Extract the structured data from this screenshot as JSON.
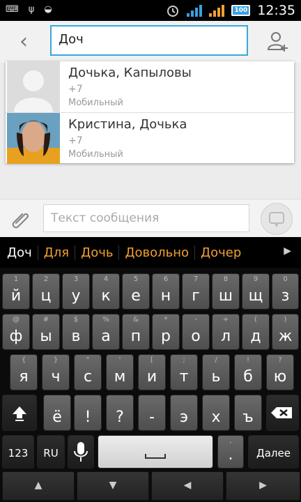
{
  "status": {
    "time": "12:35",
    "battery": "100",
    "left_icons": [
      "keyboard-icon",
      "usb-icon",
      "android-icon"
    ]
  },
  "header": {
    "recipient_value": "Доч"
  },
  "suggestions": [
    {
      "name": "Дочька, Капыловы",
      "number": "+7",
      "type": "Мобильный"
    },
    {
      "name": "Кристина, Дочька",
      "number": "+7",
      "type": "Мобильный"
    }
  ],
  "compose": {
    "placeholder": "Текст сообщения"
  },
  "keyboard": {
    "suggestions": [
      "Доч",
      "Для",
      "Дочь",
      "Довольно",
      "Дочер"
    ],
    "row1": [
      {
        "main": "й",
        "sub": "1"
      },
      {
        "main": "ц",
        "sub": "2"
      },
      {
        "main": "у",
        "sub": "3"
      },
      {
        "main": "к",
        "sub": "4"
      },
      {
        "main": "е",
        "sub": "5"
      },
      {
        "main": "н",
        "sub": "6"
      },
      {
        "main": "г",
        "sub": "7"
      },
      {
        "main": "ш",
        "sub": "8"
      },
      {
        "main": "щ",
        "sub": "9"
      },
      {
        "main": "з",
        "sub": "0"
      }
    ],
    "row2": [
      {
        "main": "ф",
        "sub": "@"
      },
      {
        "main": "ы",
        "sub": "#"
      },
      {
        "main": "в",
        "sub": "$"
      },
      {
        "main": "а",
        "sub": "%"
      },
      {
        "main": "п",
        "sub": "&"
      },
      {
        "main": "р",
        "sub": "*"
      },
      {
        "main": "о",
        "sub": "-"
      },
      {
        "main": "л",
        "sub": "+"
      },
      {
        "main": "д",
        "sub": "("
      },
      {
        "main": "ж",
        "sub": ")"
      }
    ],
    "row3": [
      {
        "main": "я",
        "sub": "{"
      },
      {
        "main": "ч",
        "sub": "}"
      },
      {
        "main": "с",
        "sub": "\""
      },
      {
        "main": "м",
        "sub": "'"
      },
      {
        "main": "и",
        "sub": "["
      },
      {
        "main": "т",
        "sub": ";"
      },
      {
        "main": "ь",
        "sub": "/"
      },
      {
        "main": "б",
        "sub": "!"
      },
      {
        "main": "ю",
        "sub": "?"
      }
    ],
    "row4": [
      {
        "main": "ё",
        "sub": ""
      },
      {
        "main": "!",
        "sub": ""
      },
      {
        "main": "?",
        "sub": ""
      },
      {
        "main": "-",
        "sub": ""
      },
      {
        "main": "э",
        "sub": ""
      },
      {
        "main": "х",
        "sub": ""
      },
      {
        "main": "ъ",
        "sub": ""
      }
    ],
    "key_123": "123",
    "key_lang": "RU",
    "key_period": ".",
    "key_period_sub": ",",
    "key_enter": "Далее"
  }
}
